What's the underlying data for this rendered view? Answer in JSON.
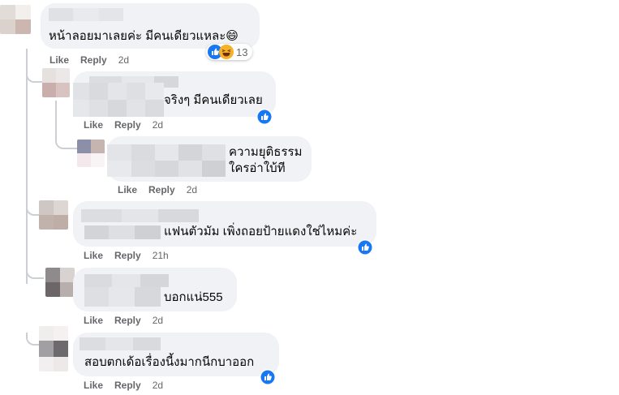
{
  "comments": [
    {
      "text": "หน้าลอยมาเลยค่ะ มีคนเดียวแหละ😄",
      "reaction_count": "13",
      "like": "Like",
      "reply": "Reply",
      "time": "2d"
    },
    {
      "text": "จริงๆ มีคนเดียวเลย",
      "like": "Like",
      "reply": "Reply",
      "time": "2d"
    },
    {
      "text_line1": "ความยุติธรรม",
      "text_line2": "ใครอ่าใบ้ที",
      "like": "Like",
      "reply": "Reply",
      "time": "2d"
    },
    {
      "text": "แฟนตัวมัม เพิ่งถอยป้ายแดงใช่ไหมค่ะ",
      "like": "Like",
      "reply": "Reply",
      "time": "21h"
    },
    {
      "text": "บอกแน่555",
      "like": "Like",
      "reply": "Reply",
      "time": "2d"
    },
    {
      "text": "สอบตกเด้อเรื่องนี้งมากนีกบาออก",
      "like": "Like",
      "reply": "Reply",
      "time": "2d"
    }
  ],
  "icons": {
    "like": "like-reaction-icon",
    "haha": "haha-reaction-icon"
  },
  "colors": {
    "bubble": "#f0f2f5",
    "meta": "#65676b",
    "like_blue": "#1877f2",
    "thread_line": "#ccd0d5"
  }
}
